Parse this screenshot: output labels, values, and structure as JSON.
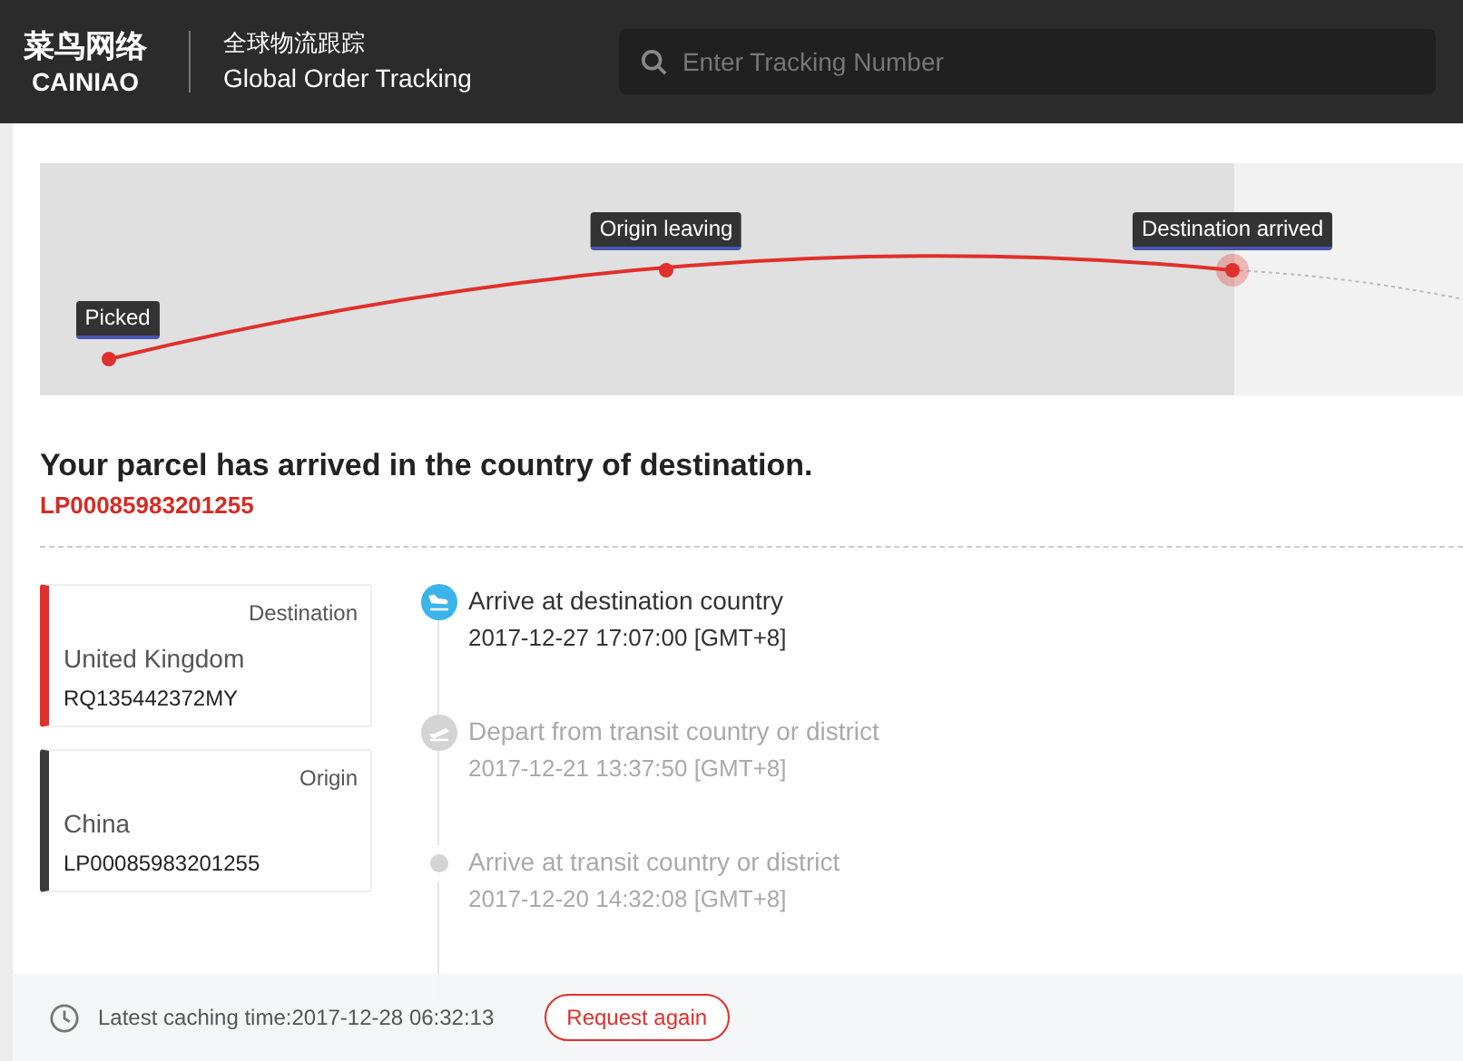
{
  "header": {
    "logo_cn": "菜鸟网络",
    "logo_en": "CAINIAO",
    "title_cn": "全球物流跟踪",
    "title_en": "Global Order Tracking",
    "search": {
      "placeholder": "Enter Tracking Number"
    }
  },
  "map": {
    "points": [
      {
        "label": "Picked",
        "current": false
      },
      {
        "label": "Origin leaving",
        "current": false
      },
      {
        "label": "Destination arrived",
        "current": true
      }
    ]
  },
  "status": {
    "headline": "Your parcel has arrived in the country of destination.",
    "tracking_number": "LP00085983201255"
  },
  "cards": [
    {
      "kind": "destination",
      "label": "Destination",
      "country": "United Kingdom",
      "number": "RQ135442372MY"
    },
    {
      "kind": "origin",
      "label": "Origin",
      "country": "China",
      "number": "LP00085983201255"
    }
  ],
  "events": [
    {
      "kind": "arrive",
      "active": true,
      "title": "Arrive at destination country",
      "time": "2017-12-27 17:07:00 [GMT+8]"
    },
    {
      "kind": "depart",
      "active": false,
      "title": "Depart from transit country or district",
      "time": "2017-12-21 13:37:50 [GMT+8]"
    },
    {
      "kind": "dot",
      "active": false,
      "title": "Arrive at transit country or district",
      "time": "2017-12-20 14:32:08 [GMT+8]"
    }
  ],
  "footer": {
    "caching": "Latest caching time:2017-12-28 06:32:13",
    "button": "Request again"
  }
}
